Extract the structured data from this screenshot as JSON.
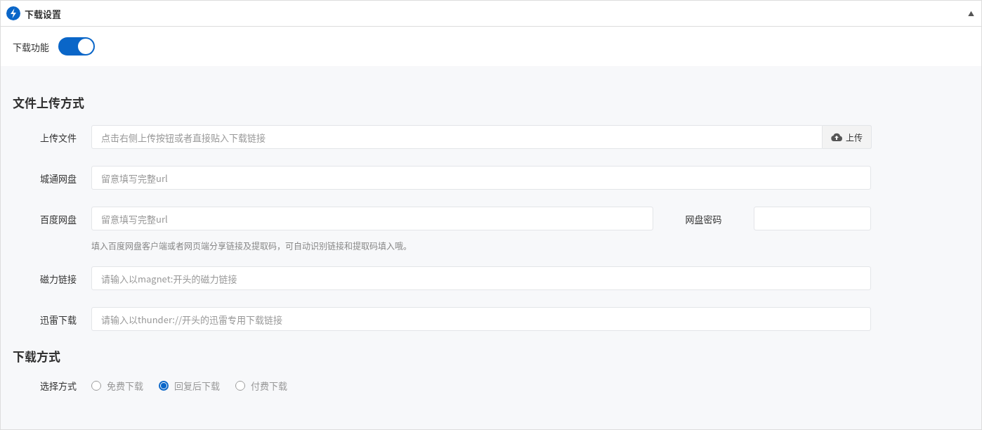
{
  "panel": {
    "title": "下载设置",
    "collapse_icon": "▲"
  },
  "download_toggle": {
    "label": "下载功能",
    "on": true
  },
  "upload_section": {
    "title": "文件上传方式",
    "fields": [
      {
        "kind": "upload",
        "label": "上传文件",
        "placeholder": "点击右侧上传按钮或者直接贴入下载链接",
        "button": "上传"
      },
      {
        "kind": "text",
        "label": "城通网盘",
        "placeholder": "留意填写完整url"
      },
      {
        "kind": "split",
        "label": "百度网盘",
        "placeholder": "留意填写完整url",
        "side_label": "网盘密码",
        "hint": "填入百度网盘客户端或者网页端分享链接及提取码，可自动识别链接和提取码填入哦。"
      },
      {
        "kind": "text",
        "label": "磁力链接",
        "placeholder": "请输入以magnet:开头的磁力链接"
      },
      {
        "kind": "text",
        "label": "迅雷下载",
        "placeholder": "请输入以thunder://开头的迅雷专用下载链接"
      }
    ]
  },
  "download_section": {
    "title": "下载方式",
    "label": "选择方式",
    "options": [
      {
        "label": "免费下载",
        "selected": false
      },
      {
        "label": "回复后下载",
        "selected": true
      },
      {
        "label": "付费下载",
        "selected": false
      }
    ]
  }
}
